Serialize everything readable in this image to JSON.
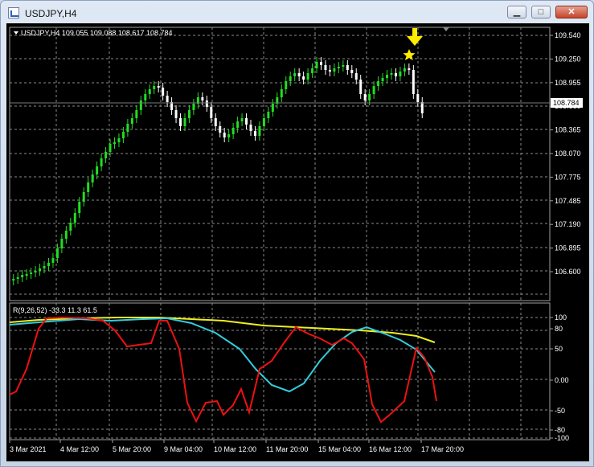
{
  "window": {
    "title": "USDJPY,H4",
    "minimize_glyph": "▁",
    "maximize_glyph": "□",
    "close_glyph": "✕"
  },
  "main_chart": {
    "header": "USDJPY,H4  109.055 109.088 108.617 108.784",
    "price_axis": [
      "109.540",
      "109.250",
      "108.955",
      "108.660",
      "108.365",
      "108.070",
      "107.775",
      "107.485",
      "107.190",
      "106.895",
      "106.600"
    ],
    "current_price": "108.784",
    "colors": {
      "bull": "#22dd22",
      "bear": "#ffffff",
      "background": "#000000",
      "grid": "#8a8a8a",
      "arrow": "#ffee00"
    }
  },
  "indicator": {
    "header": "R(9,26,52) -33.3 11.3 61.5",
    "axis": [
      "100",
      "80",
      "50",
      "0.00",
      "-50",
      "-80",
      "-100"
    ],
    "colors": {
      "red": "#ee1111",
      "cyan": "#33ccdd",
      "yellow": "#eeee22"
    }
  },
  "time_axis": [
    "3 Mar 2021",
    "4 Mar 12:00",
    "5 Mar 20:00",
    "9 Mar 04:00",
    "10 Mar 12:00",
    "11 Mar 20:00",
    "15 Mar 04:00",
    "16 Mar 12:00",
    "17 Mar 20:00"
  ]
}
